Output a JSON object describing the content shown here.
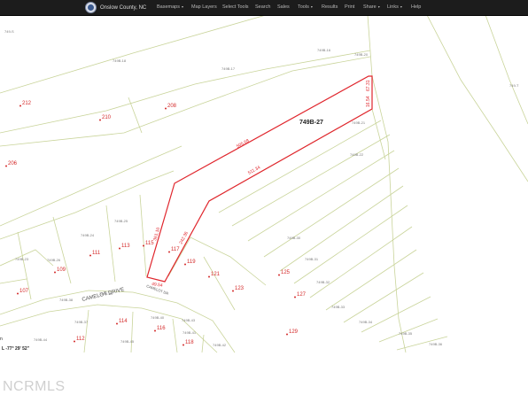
{
  "navbar": {
    "title": "Onslow County, NC",
    "menu": [
      {
        "label": "Basemaps",
        "caret": true
      },
      {
        "label": "Map Layers",
        "caret": false
      },
      {
        "label": "Select Tools",
        "caret": false
      },
      {
        "label": "Search",
        "caret": false
      },
      {
        "label": "Sales",
        "caret": false
      },
      {
        "label": "Tools",
        "caret": true
      },
      {
        "label": "Results",
        "caret": false
      },
      {
        "label": "Print",
        "caret": false
      },
      {
        "label": "Share",
        "caret": true
      },
      {
        "label": "Links",
        "caret": true
      },
      {
        "label": "Help",
        "caret": false
      }
    ]
  },
  "map": {
    "selected_parcel": {
      "label": "749B-27",
      "dims": [
        "505.68",
        "511.34",
        "361.10",
        "242.36",
        "49.54",
        "67.31",
        "16.54"
      ]
    },
    "address_numbers": [
      "212",
      "210",
      "208",
      "206",
      "113",
      "115",
      "117",
      "111",
      "109",
      "107",
      "119",
      "121",
      "123",
      "125",
      "127",
      "129",
      "114",
      "116",
      "118",
      "112"
    ],
    "parcel_ids": [
      "749-S",
      "749B-16",
      "749B-17",
      "749B-18",
      "749B-20",
      "749B-21",
      "749B-22",
      "749B-23",
      "749B-24",
      "749B-25",
      "749B-26",
      "749B-30",
      "749B-31",
      "749B-32",
      "749B-33",
      "749B-34",
      "749B-35",
      "749B-36",
      "749B-37",
      "749B-38",
      "749B-39",
      "749B-40",
      "749B-41",
      "749B-42",
      "749B-43",
      "749B-44",
      "749B-45",
      "749-T"
    ],
    "street_labels": [
      "CAMELOT DRIVE",
      "CAMELOT DR"
    ],
    "coordinates": "L -77° 29' 52\"",
    "coord_partial": "n",
    "parcel_line_color": "#c9d49a",
    "highlight_color": "#e0262d",
    "address_color": "#d42a2a"
  },
  "watermark": "NCRMLS"
}
